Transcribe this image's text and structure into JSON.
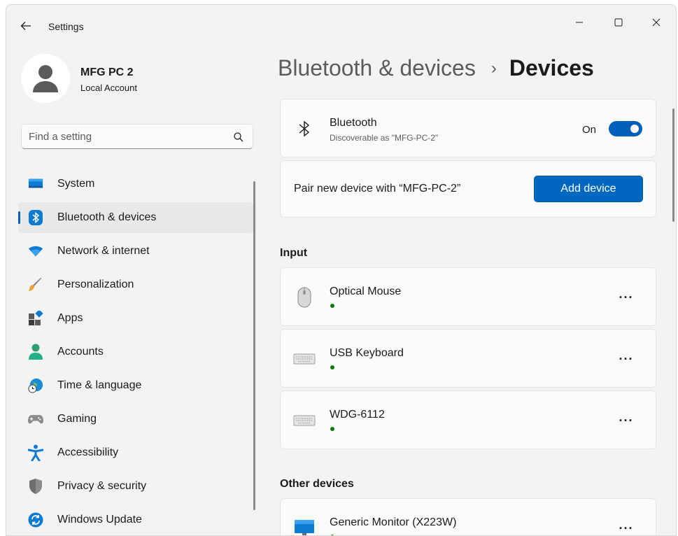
{
  "window": {
    "title": "Settings",
    "controls": {
      "minimize": "—",
      "maximize": "☐",
      "close": "✕"
    }
  },
  "profile": {
    "name": "MFG PC 2",
    "type": "Local Account"
  },
  "search": {
    "placeholder": "Find a setting"
  },
  "nav": {
    "items": [
      {
        "label": "System",
        "icon": "system-icon",
        "selected": false
      },
      {
        "label": "Bluetooth & devices",
        "icon": "bluetooth-icon",
        "selected": true
      },
      {
        "label": "Network & internet",
        "icon": "wifi-icon",
        "selected": false
      },
      {
        "label": "Personalization",
        "icon": "brush-icon",
        "selected": false
      },
      {
        "label": "Apps",
        "icon": "apps-icon",
        "selected": false
      },
      {
        "label": "Accounts",
        "icon": "person-icon",
        "selected": false
      },
      {
        "label": "Time & language",
        "icon": "globe-clock-icon",
        "selected": false
      },
      {
        "label": "Gaming",
        "icon": "gamepad-icon",
        "selected": false
      },
      {
        "label": "Accessibility",
        "icon": "accessibility-icon",
        "selected": false
      },
      {
        "label": "Privacy & security",
        "icon": "shield-icon",
        "selected": false
      },
      {
        "label": "Windows Update",
        "icon": "update-icon",
        "selected": false
      }
    ]
  },
  "breadcrumb": {
    "parent": "Bluetooth & devices",
    "separator": "›",
    "current": "Devices"
  },
  "bluetooth": {
    "title": "Bluetooth",
    "subtitle": "Discoverable as \"MFG-PC-2\"",
    "toggle_label": "On",
    "enabled": true
  },
  "pair": {
    "label": "Pair new device with “MFG-PC-2”",
    "button": "Add device"
  },
  "sections": {
    "input": {
      "title": "Input",
      "devices": [
        {
          "name": "Optical Mouse",
          "icon": "mouse-icon",
          "more": "···"
        },
        {
          "name": "USB Keyboard",
          "icon": "keyboard-icon",
          "more": "···"
        },
        {
          "name": "WDG-6112",
          "icon": "keyboard-icon",
          "more": "···"
        }
      ]
    },
    "other": {
      "title": "Other devices",
      "devices": [
        {
          "name": "Generic Monitor (X223W)",
          "icon": "monitor-icon",
          "more": "···"
        }
      ]
    }
  },
  "colors": {
    "accent": "#005fb8",
    "button": "#0067c0",
    "status_ok": "#0f7b0f",
    "window_bg": "#f3f3f3",
    "card_bg": "#fbfbfb"
  }
}
